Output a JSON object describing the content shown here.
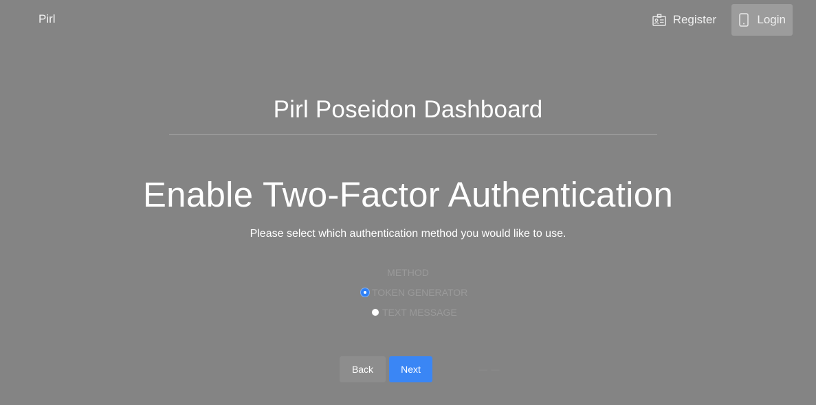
{
  "nav": {
    "brand": "Pirl",
    "register_label": "Register",
    "login_label": "Login",
    "register_icon": "id-card-icon",
    "login_icon": "mobile-phone-icon"
  },
  "header": {
    "site_title": "Pirl Poseidon Dashboard"
  },
  "main": {
    "heading": "Enable Two-Factor Authentication",
    "subtext": "Please select which authentication method you would like to use.",
    "method_label": "METHOD",
    "options": [
      {
        "label": "TOKEN GENERATOR",
        "checked": true
      },
      {
        "label": "TEXT MESSAGE",
        "checked": false
      }
    ]
  },
  "actions": {
    "back_label": "Back",
    "next_label": "Next"
  },
  "colors": {
    "background": "#848484",
    "accent": "#3a86f5",
    "login_active_bg": "#9c9c9c"
  }
}
